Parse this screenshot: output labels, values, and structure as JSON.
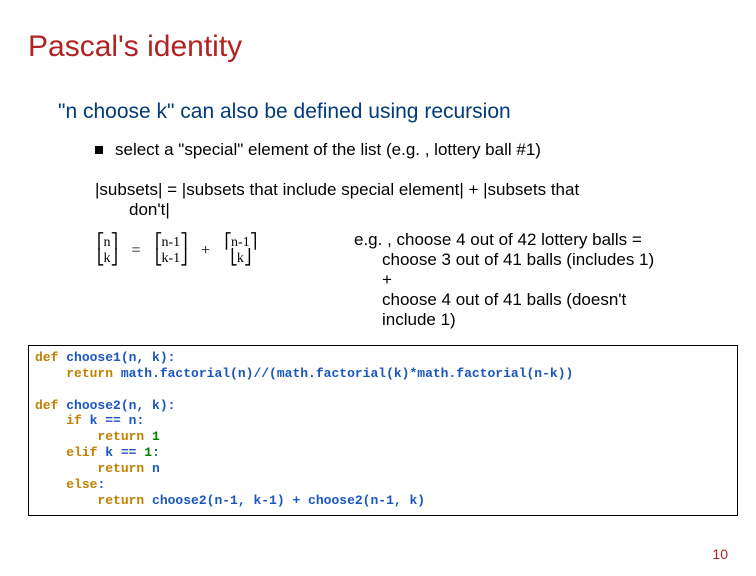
{
  "title": "Pascal's identity",
  "subtitle": "\"n choose k\" can also be defined using recursion",
  "bullet": "select a \"special\" element of the list  (e.g. , lottery ball #1)",
  "subsets_line_1": "|subsets| = |subsets that include special element| + |subsets that",
  "subsets_line_2": "don't|",
  "formula": {
    "l_top": "n",
    "l_bot": "k",
    "m_top": "n-1",
    "m_bot": "k-1",
    "r_top": "n-1",
    "r_bot": "k",
    "eq": "=",
    "plus": "+",
    "lb_top": "⎡",
    "lb_bot": "⎣",
    "rb_top": "⎤",
    "rb_bot": "⎦"
  },
  "eg": {
    "line1": "e.g. , choose 4 out of 42 lottery balls =",
    "line2": "choose 3 out of 41 balls  (includes 1)",
    "line3": "+",
    "line4": "choose 4 out of 41 balls (doesn't",
    "line5": "include 1)"
  },
  "code": {
    "def": "def ",
    "ret": "return ",
    "if": "if ",
    "elif": "elif ",
    "else": "else",
    "choose1_sig": "choose1(n, k):",
    "choose1_body": "math.factorial(n)//(math.factorial(k)*math.factorial(n-k))",
    "choose2_sig": "choose2(n, k):",
    "cond1_a": "k ",
    "cond1_b": "== n:",
    "ret1": "1",
    "cond2_a": "k ",
    "cond2_b": "== ",
    "cond2_c": "1",
    "cond2_d": ":",
    "ret2": "n",
    "colon": ":",
    "ret3": "choose2(n-1, k-1) + choose2(n-1, k)",
    "ind1": "    ",
    "ind2": "        "
  },
  "page_number": "10"
}
